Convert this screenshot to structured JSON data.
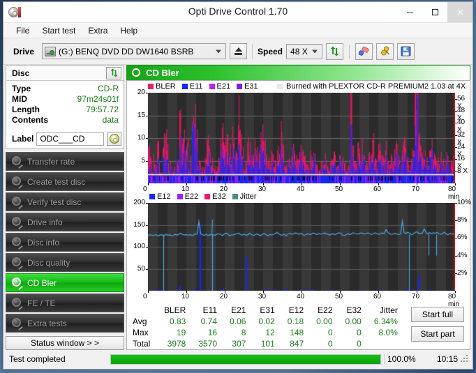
{
  "window": {
    "title": "Opti Drive Control 1.70",
    "app_icon": "disc-icon",
    "minimize": "–",
    "maximize": "□",
    "close": "×"
  },
  "menubar": {
    "items": [
      "File",
      "Start test",
      "Extra",
      "Help"
    ]
  },
  "toolbar": {
    "drive_label": "Drive",
    "drive_value": "(G:)   BENQ DVD DD DW1640 BSRB",
    "eject_icon": "eject-icon",
    "speed_label": "Speed",
    "speed_value": "48 X",
    "refresh_icon": "refresh-icon",
    "eraser_icon": "eraser-icon",
    "tools_icon": "tools-icon",
    "save_icon": "save-floppy-icon"
  },
  "disc": {
    "header": "Disc",
    "refresh_icon": "refresh-icon",
    "rows": [
      {
        "key": "Type",
        "value": "CD-R"
      },
      {
        "key": "MID",
        "value": "97m24s01f"
      },
      {
        "key": "Length",
        "value": "79:57.72"
      },
      {
        "key": "Contents",
        "value": "data"
      }
    ],
    "label_key": "Label",
    "label_value": "ODC___CD",
    "label_placeholder": "",
    "disc_button_icon": "cd-disc-icon"
  },
  "nav": {
    "items": [
      {
        "label": "Transfer rate",
        "icon": "disc-icon",
        "active": false
      },
      {
        "label": "Create test disc",
        "icon": "disc-icon",
        "active": false
      },
      {
        "label": "Verify test disc",
        "icon": "disc-icon",
        "active": false
      },
      {
        "label": "Drive info",
        "icon": "disc-icon",
        "active": false
      },
      {
        "label": "Disc info",
        "icon": "disc-icon",
        "active": false
      },
      {
        "label": "Disc quality",
        "icon": "disc-icon",
        "active": false
      },
      {
        "label": "CD Bler",
        "icon": "disc-icon",
        "active": true
      },
      {
        "label": "FE / TE",
        "icon": "disc-icon",
        "active": false
      },
      {
        "label": "Extra tests",
        "icon": "disc-icon",
        "active": false
      }
    ],
    "status_window_label": "Status window > >"
  },
  "panel": {
    "title": "CD Bler",
    "title_icon": "disc-icon",
    "burn_note": "Burned with PLEXTOR CD-R   PREMIUM2 1.03 at 4X",
    "burn_swatch_color": "#e8e8e8"
  },
  "stats": {
    "columns": [
      "BLER",
      "E11",
      "E21",
      "E31",
      "E12",
      "E22",
      "E32",
      "Jitter"
    ],
    "rows": [
      {
        "label": "Avg",
        "values": [
          "0.83",
          "0.74",
          "0.06",
          "0.02",
          "0.18",
          "0.00",
          "0.00",
          "6.34%"
        ]
      },
      {
        "label": "Max",
        "values": [
          "19",
          "16",
          "8",
          "12",
          "148",
          "0",
          "0",
          "8.0%"
        ]
      },
      {
        "label": "Total",
        "values": [
          "3978",
          "3570",
          "307",
          "101",
          "847",
          "0",
          "0",
          ""
        ]
      }
    ],
    "start_full": "Start full",
    "start_part": "Start part"
  },
  "statusbar": {
    "text": "Test completed",
    "percent": "100.0%",
    "progress": 100,
    "time": "10:15"
  },
  "chart_data": [
    {
      "type": "bar",
      "id": "bler-chart",
      "title": "",
      "xlabel": "min",
      "ylabel": "",
      "xlim": [
        0,
        80
      ],
      "ylim": [
        0,
        20
      ],
      "xticks": [
        0,
        10,
        20,
        30,
        40,
        50,
        60,
        70,
        80
      ],
      "xticklabels": [
        "0",
        "10",
        "20",
        "30",
        "40",
        "50",
        "60",
        "70",
        "80 min"
      ],
      "yticks": [
        5,
        10,
        15,
        20
      ],
      "yticklabels": [
        "5",
        "10",
        "15",
        "20"
      ],
      "y2label": "",
      "y2lim": [
        0,
        60
      ],
      "y2ticks": [
        8,
        16,
        24,
        32,
        40,
        48,
        56
      ],
      "y2ticklabels": [
        "8 X",
        "16 X",
        "24 X",
        "32 X",
        "40 X",
        "48 X",
        "56 X"
      ],
      "grid": true,
      "background": "#2a2a2a",
      "legend": [
        {
          "name": "BLER",
          "color": "#f0186a"
        },
        {
          "name": "E11",
          "color": "#1428f0"
        },
        {
          "name": "E21",
          "color": "#c020f0"
        },
        {
          "name": "E31",
          "color": "#7a20e0"
        }
      ],
      "series": [
        {
          "name": "BLER",
          "color": "#f0186a",
          "values": [
            8,
            7,
            3,
            6,
            4,
            9,
            4,
            3,
            11,
            10,
            12,
            5,
            6,
            3,
            4,
            5,
            6,
            16,
            10,
            11,
            7,
            11,
            3,
            6,
            18,
            17,
            15,
            6,
            5,
            4,
            3,
            6,
            12,
            11,
            5,
            6,
            4,
            3,
            5,
            9,
            12,
            12,
            10,
            11,
            8,
            6,
            14,
            10,
            7,
            19,
            12,
            8,
            4,
            5,
            10,
            9,
            7,
            6,
            11,
            9,
            8,
            13,
            12,
            10,
            6,
            5,
            4,
            7,
            6,
            5,
            8,
            7,
            13,
            9,
            5,
            4,
            7,
            6,
            8,
            10,
            6,
            5,
            9,
            10,
            7,
            6,
            5,
            4,
            7,
            6,
            10,
            5,
            4,
            3,
            6,
            5,
            7,
            4,
            3,
            5,
            6,
            8,
            4,
            5,
            9,
            7,
            6,
            4,
            3,
            5,
            24,
            8,
            6,
            5,
            9,
            7,
            10,
            8,
            6,
            5,
            9,
            7,
            12,
            6,
            5,
            8,
            10,
            7,
            6,
            9,
            5,
            4,
            7,
            6,
            8,
            10,
            7,
            5,
            9,
            11,
            8,
            6,
            5,
            7,
            10,
            24,
            32,
            12,
            8,
            7,
            9,
            6,
            5,
            8,
            11,
            7,
            6,
            5,
            4,
            7,
            6,
            5,
            8,
            6,
            4,
            5,
            7
          ]
        },
        {
          "name": "E11",
          "color": "#1428f0",
          "values": [
            3,
            5,
            2,
            4,
            3,
            7,
            2,
            2,
            7,
            6,
            5,
            3,
            4,
            2,
            3,
            16,
            4,
            10,
            6,
            9,
            4,
            8,
            2,
            4,
            15,
            12,
            10,
            4,
            3,
            2,
            2,
            4,
            6,
            7,
            3,
            4,
            2,
            2,
            3,
            6,
            8,
            6,
            7,
            6,
            5,
            4,
            9,
            7,
            5,
            12,
            8,
            5,
            3,
            3,
            7,
            6,
            5,
            4,
            8,
            6,
            5,
            10,
            9,
            7,
            4,
            3,
            3,
            5,
            4,
            3,
            6,
            5,
            9,
            7,
            3,
            3,
            5,
            4,
            6,
            7,
            4,
            3,
            6,
            7,
            5,
            4,
            3,
            3,
            5,
            4,
            7,
            3,
            3,
            2,
            4,
            3,
            5,
            3,
            2,
            4,
            4,
            6,
            3,
            4,
            6,
            5,
            4,
            3,
            2,
            4,
            12,
            6,
            4,
            3,
            6,
            5,
            7,
            6,
            4,
            3,
            6,
            5,
            8,
            4,
            3,
            6,
            7,
            5,
            4,
            6,
            3,
            3,
            5,
            4,
            6,
            7,
            5,
            4,
            6,
            8,
            6,
            4,
            3,
            5,
            7,
            14,
            20,
            8,
            6,
            5,
            6,
            4,
            3,
            6,
            8,
            5,
            4,
            3,
            3,
            5,
            4,
            3,
            6,
            4,
            3,
            3,
            5
          ]
        },
        {
          "name": "E21",
          "color": "#c020f0",
          "values": [
            1,
            1,
            0,
            1,
            0,
            1,
            0,
            0,
            1,
            1,
            1,
            0,
            1,
            0,
            0,
            1,
            1,
            2,
            1,
            1,
            0,
            1,
            0,
            1,
            2,
            1,
            1,
            0,
            1,
            0,
            0,
            1,
            1,
            1,
            0,
            1,
            0,
            0,
            1,
            1,
            1,
            1,
            1,
            1,
            0,
            1,
            2,
            1,
            1,
            1,
            1,
            1,
            0,
            1,
            1,
            1,
            1,
            0,
            1,
            1,
            1,
            1,
            1,
            1,
            0,
            1,
            0,
            1,
            1,
            0,
            1,
            1,
            1,
            1,
            0,
            0,
            1,
            1,
            1,
            1,
            1,
            0,
            1,
            1,
            1,
            0,
            1,
            0,
            1,
            1,
            1,
            0,
            0,
            0,
            1,
            1,
            1,
            0,
            0,
            1,
            1,
            1,
            0,
            1,
            1,
            1,
            1,
            0,
            0,
            1,
            2,
            1,
            1,
            0,
            1,
            1,
            1,
            1,
            1,
            0,
            1,
            1,
            1,
            1,
            0,
            1,
            1,
            1,
            1,
            1,
            0,
            0,
            1,
            1,
            1,
            1,
            1,
            0,
            1,
            1,
            1,
            1,
            0,
            1,
            1,
            2,
            2,
            1,
            1,
            1,
            1,
            1,
            0,
            1,
            1,
            1,
            1,
            0,
            0,
            1,
            1,
            1,
            1,
            1,
            0,
            0,
            1
          ]
        }
      ],
      "speed_curve": {
        "name": "speed",
        "color": "#ffffff",
        "note": "horizontal white line near bottom of plot, ~4X"
      }
    },
    {
      "type": "line",
      "id": "e12-jitter-chart",
      "title": "",
      "xlabel": "min",
      "ylabel": "",
      "xlim": [
        0,
        80
      ],
      "ylim": [
        0,
        200
      ],
      "xticks": [
        0,
        10,
        20,
        30,
        40,
        50,
        60,
        70,
        80
      ],
      "xticklabels": [
        "0",
        "10",
        "20",
        "30",
        "40",
        "50",
        "60",
        "70",
        "80 min"
      ],
      "yticks": [
        50,
        100,
        150,
        200
      ],
      "yticklabels": [
        "50",
        "100",
        "150",
        "200"
      ],
      "y2lim": [
        0,
        10
      ],
      "y2ticks": [
        2,
        4,
        6,
        8,
        10
      ],
      "y2ticklabels": [
        "2%",
        "4%",
        "6%",
        "8%",
        "10%"
      ],
      "grid": true,
      "background": "#2a2a2a",
      "legend": [
        {
          "name": "E12",
          "color": "#1428f0"
        },
        {
          "name": "E22",
          "color": "#a020f0"
        },
        {
          "name": "E32",
          "color": "#f0186a"
        },
        {
          "name": "Jitter",
          "color": "#4a8a8a"
        }
      ],
      "series": [
        {
          "name": "E12",
          "color": "#1428f0",
          "values": [
            0,
            0,
            0,
            0,
            0,
            0,
            0,
            0,
            0,
            0,
            0,
            0,
            0,
            0,
            0,
            0,
            0,
            12,
            0,
            0,
            0,
            0,
            0,
            0,
            0,
            5,
            0,
            0,
            148,
            0,
            0,
            0,
            0,
            0,
            0,
            0,
            0,
            0,
            0,
            0,
            4,
            0,
            0,
            0,
            0,
            0,
            0,
            0,
            0,
            0,
            0,
            0,
            0,
            76,
            0,
            0,
            0,
            0,
            0,
            0,
            0,
            0,
            0,
            0,
            6,
            0,
            0,
            0,
            0,
            0,
            0,
            0,
            0,
            0,
            0,
            0,
            0,
            0,
            0,
            0,
            0,
            0,
            0,
            0,
            0,
            0,
            0,
            0,
            0,
            4,
            0,
            0,
            0,
            0,
            0,
            0,
            0,
            0,
            0,
            0,
            0,
            0,
            0,
            0,
            0,
            0,
            0,
            0,
            0,
            0,
            0,
            0,
            0,
            0,
            0,
            0,
            0,
            0,
            0,
            0,
            0,
            0,
            0,
            0,
            0,
            0,
            0,
            0,
            0,
            0,
            0,
            0,
            0,
            0,
            0,
            0,
            0,
            0,
            0,
            0,
            0,
            3,
            0,
            0,
            0,
            0,
            0,
            34,
            0,
            0,
            0,
            0,
            0,
            0,
            0,
            0,
            0,
            0,
            0,
            0,
            0,
            0,
            0,
            0,
            0,
            0,
            0
          ]
        },
        {
          "name": "Jitter",
          "color": "#4aa8e0",
          "unit": "%",
          "values": [
            6.3,
            6.4,
            6.3,
            6.3,
            6.4,
            6.3,
            6.3,
            6.4,
            6.3,
            6.3,
            6.4,
            6.3,
            6.4,
            6.3,
            6.3,
            6.4,
            6.3,
            6.4,
            6.5,
            6.4,
            6.3,
            6.4,
            6.3,
            6.4,
            6.3,
            6.4,
            6.5,
            6.4,
            7.9,
            6.5,
            6.4,
            6.3,
            6.4,
            6.3,
            6.4,
            6.3,
            6.4,
            6.3,
            6.4,
            6.5,
            6.4,
            6.3,
            6.4,
            6.5,
            6.4,
            6.3,
            6.4,
            6.3,
            6.4,
            6.5,
            6.6,
            6.4,
            6.3,
            6.4,
            6.3,
            6.4,
            6.5,
            6.4,
            6.3,
            6.4,
            6.5,
            6.4,
            6.3,
            6.4,
            6.5,
            6.4,
            6.3,
            6.4,
            6.3,
            6.4,
            6.5,
            6.6,
            6.5,
            6.4,
            6.3,
            6.4,
            6.3,
            6.4,
            6.5,
            6.4,
            6.5,
            6.6,
            6.5,
            6.4,
            6.5,
            6.4,
            6.3,
            6.4,
            6.5,
            6.4,
            6.5,
            6.6,
            6.5,
            6.4,
            6.5,
            6.4,
            6.5,
            6.6,
            6.5,
            6.4,
            6.3,
            6.4,
            6.5,
            6.4,
            6.5,
            6.6,
            6.5,
            6.4,
            6.3,
            6.4,
            6.5,
            6.4,
            6.5,
            6.6,
            6.5,
            6.4,
            6.5,
            6.6,
            6.5,
            6.4,
            6.5,
            6.6,
            6.5,
            6.4,
            6.5,
            6.6,
            6.5,
            6.4,
            6.5,
            6.6,
            6.5,
            7.0,
            6.6,
            6.5,
            6.4,
            6.5,
            6.6,
            6.5,
            6.4,
            6.5,
            7.9,
            6.6,
            6.5,
            6.6,
            6.5,
            6.4,
            6.5,
            6.6,
            6.7,
            6.6,
            6.5,
            6.6,
            7.1,
            6.6,
            6.5,
            6.6,
            6.5,
            6.6,
            6.5,
            6.6,
            6.5,
            6.4,
            6.5,
            6.6,
            6.5,
            6.4,
            6.5,
            6.4,
            6.5,
            6.4
          ]
        }
      ]
    }
  ]
}
